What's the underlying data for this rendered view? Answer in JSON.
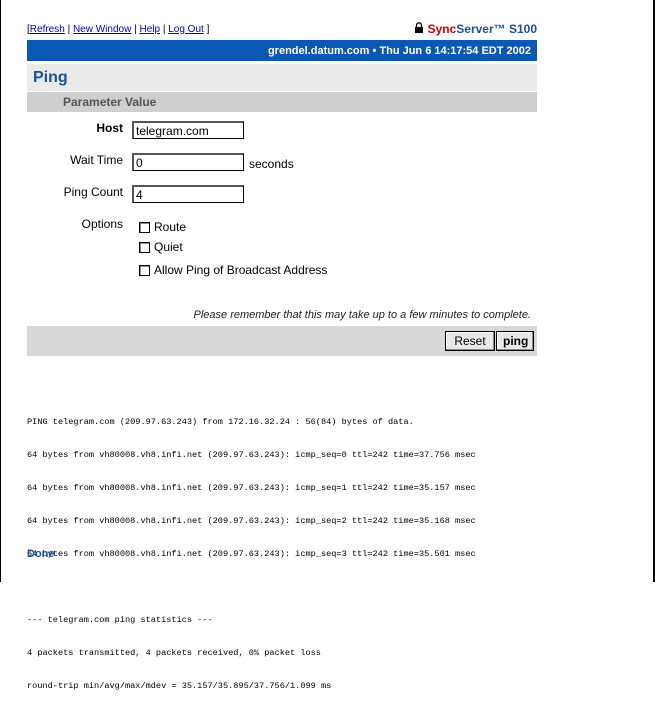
{
  "toplinks": {
    "open_bracket": "[",
    "refresh": "Refresh",
    "sep1": " | ",
    "new_window": "New Window",
    "sep2": " | ",
    "help": "Help",
    "sep3": " | ",
    "logout": "Log Out",
    "close_bracket": " ]"
  },
  "brand": {
    "sync": "Sync",
    "rest": "Server™ S100",
    "lock_icon": "lock-icon"
  },
  "status_bar": "grendel.datum.com  •  Thu Jun 6 14:17:54 EDT 2002",
  "page_title": "Ping",
  "table_header": {
    "parameter": "Parameter",
    "value": "Value"
  },
  "fields": {
    "host": {
      "label": "Host",
      "value": "telegram.com"
    },
    "wait_time": {
      "label": "Wait Time",
      "value": "0",
      "unit": "seconds"
    },
    "ping_count": {
      "label": "Ping Count",
      "value": "4"
    }
  },
  "options": {
    "label": "Options",
    "items": [
      {
        "label": "Route",
        "checked": false
      },
      {
        "label": "Quiet",
        "checked": false
      },
      {
        "label": "Allow Ping of Broadcast Address",
        "checked": false
      }
    ]
  },
  "note": "Please remember that this may take up to a few minutes to complete.",
  "buttons": {
    "reset": "Reset",
    "ping": "ping"
  },
  "output": {
    "lines": [
      "PING telegram.com (209.97.63.243) from 172.16.32.24 : 56(84) bytes of data.",
      "64 bytes from vh80008.vh8.infi.net (209.97.63.243): icmp_seq=0 ttl=242 time=37.756 msec",
      "64 bytes from vh80008.vh8.infi.net (209.97.63.243): icmp_seq=1 ttl=242 time=35.157 msec",
      "64 bytes from vh80008.vh8.infi.net (209.97.63.243): icmp_seq=2 ttl=242 time=35.168 msec",
      "64 bytes from vh80008.vh8.infi.net (209.97.63.243): icmp_seq=3 ttl=242 time=35.501 msec",
      "",
      "--- telegram.com ping statistics ---",
      "4 packets transmitted, 4 packets received, 0% packet loss",
      "round-trip min/avg/max/mdev = 35.157/35.895/37.756/1.099 ms"
    ]
  },
  "done": "Done",
  "colors": {
    "accent": "#0a58b4",
    "title": "#1a4f9a",
    "brand_red": "#cc0000"
  }
}
